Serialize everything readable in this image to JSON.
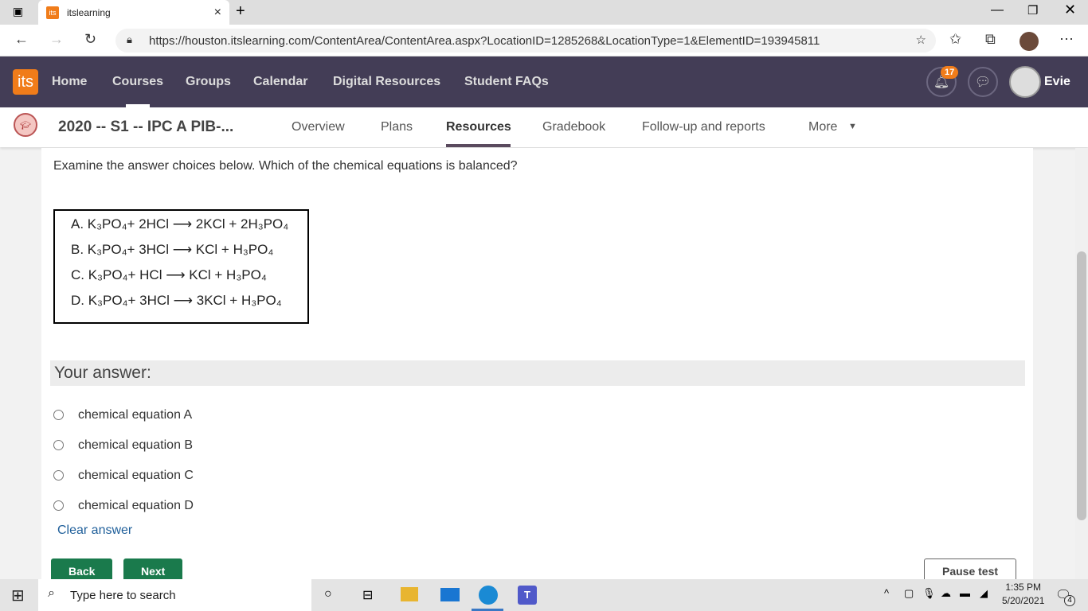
{
  "browser": {
    "tab_title": "itslearning",
    "favicon": "its",
    "url": "https://houston.itslearning.com/ContentArea/ContentArea.aspx?LocationID=1285268&LocationType=1&ElementID=193945811"
  },
  "nav": {
    "logo": "its",
    "items": [
      "Home",
      "Courses",
      "Groups",
      "Calendar",
      "Digital Resources",
      "Student FAQs"
    ],
    "notifications": "17",
    "user": "Evie"
  },
  "course": {
    "title": "2020 -- S1 -- IPC A PIB-...",
    "tabs": [
      "Overview",
      "Plans",
      "Resources",
      "Gradebook",
      "Follow-up and reports",
      "More"
    ],
    "active": "Resources"
  },
  "question": {
    "prompt": "Examine the answer choices below. Which of the chemical equations is balanced?",
    "equations": [
      "A. K₃PO₄+ 2HCl  ⟶ 2KCl + 2H₃PO₄",
      "B. K₃PO₄+ 3HCl  ⟶ KCl + H₃PO₄",
      "C. K₃PO₄+ HCl  ⟶ KCl + H₃PO₄",
      "D. K₃PO₄+ 3HCl  ⟶ 3KCl + H₃PO₄"
    ],
    "answer_heading": "Your answer:",
    "options": [
      "chemical equation A",
      "chemical equation B",
      "chemical equation C",
      "chemical equation D"
    ],
    "clear": "Clear answer",
    "back": "Back",
    "next": "Next",
    "pause": "Pause test"
  },
  "taskbar": {
    "search_placeholder": "Type here to search",
    "time": "1:35 PM",
    "date": "5/20/2021",
    "notif_count": "4"
  }
}
